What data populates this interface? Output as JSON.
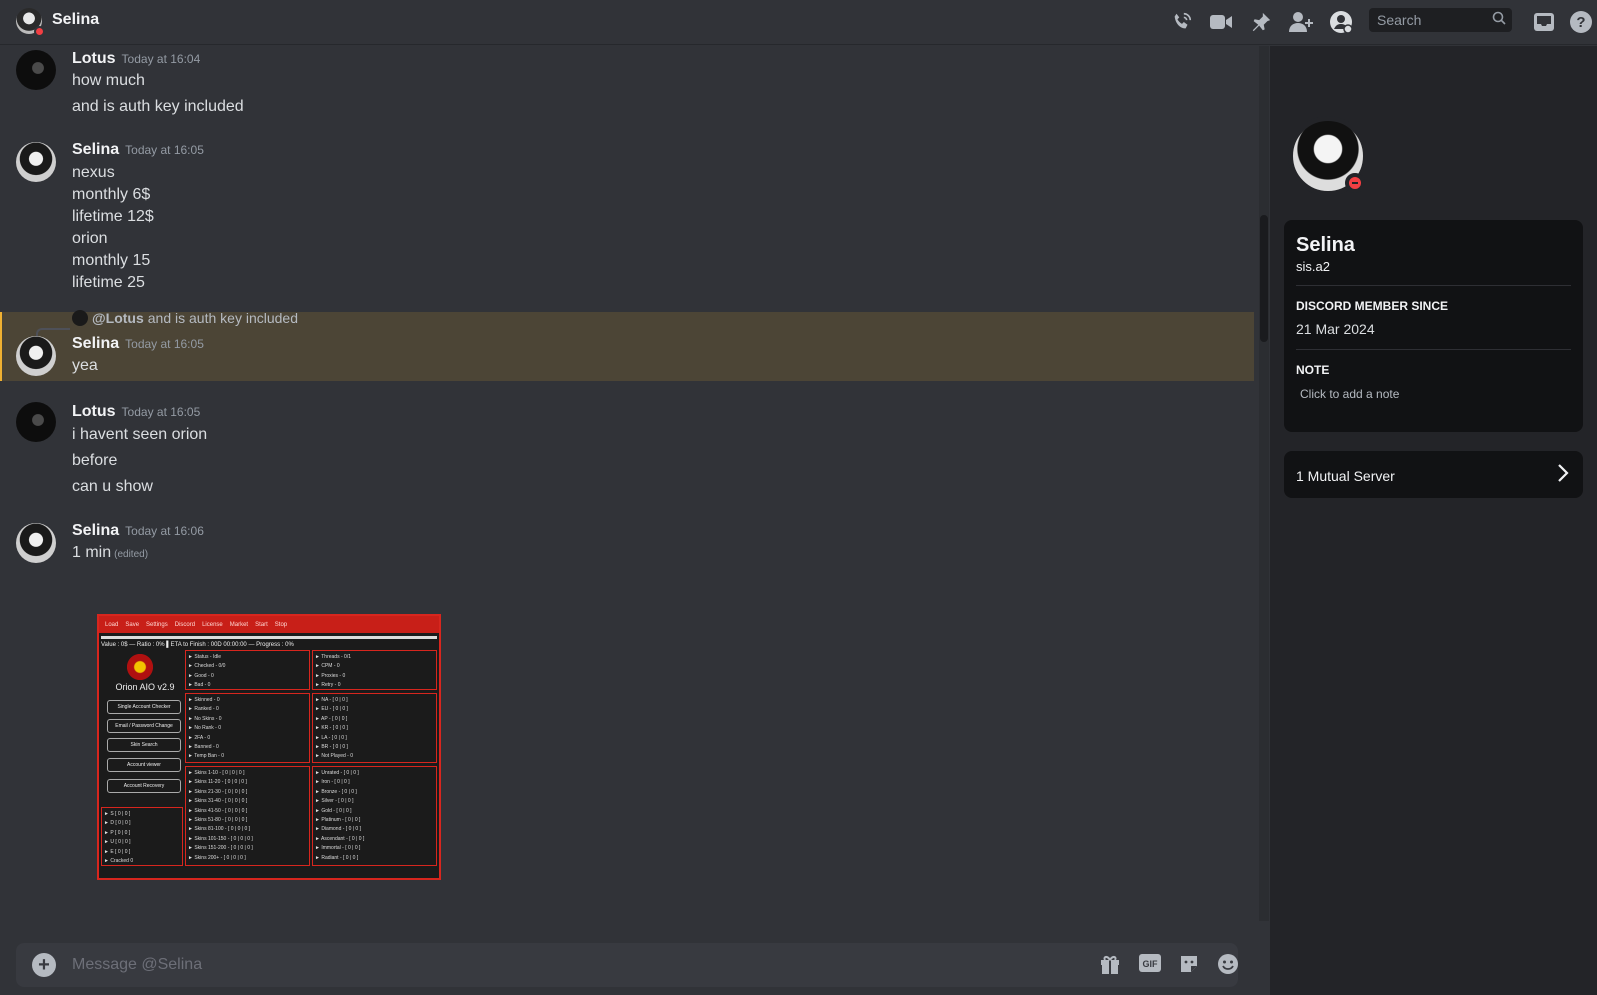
{
  "header": {
    "title": "Selina",
    "search_placeholder": "Search",
    "icons": [
      "call-icon",
      "video-icon",
      "pin-icon",
      "add-friend-icon",
      "profile-icon",
      "inbox-icon",
      "help-icon"
    ]
  },
  "messages": [
    {
      "author": "Lotus",
      "time": "Today at 16:04",
      "lines": [
        "how much",
        "and is auth key included"
      ]
    },
    {
      "author": "Selina",
      "time": "Today at 16:05",
      "lines": [
        "nexus",
        "monthly 6$",
        "lifetime 12$",
        "orion",
        "monthly 15",
        "lifetime 25"
      ]
    },
    {
      "author": "Selina",
      "time": "Today at 16:05",
      "reply": {
        "mention": "@Lotus",
        "text": "and is auth key included"
      },
      "lines": [
        "yea"
      ]
    },
    {
      "author": "Lotus",
      "time": "Today at 16:05",
      "lines": [
        "i havent seen orion",
        "before",
        "can u show"
      ]
    },
    {
      "author": "Selina",
      "time": "Today at 16:06",
      "lines": [
        "1 min"
      ],
      "edited": "(edited)"
    }
  ],
  "attachment": {
    "toolbar": [
      "Load",
      "Save",
      "Settings",
      "Discord",
      "License",
      "Market",
      "Start",
      "Stop"
    ],
    "stats": "Value : 0$  —  Ratio : 0%   ▌ETA to Finish : 00D 00:00:00  —  Progress : 0%",
    "brand": "Orion AIO v2.9",
    "buttons": [
      "Single Account Checker",
      "Email / Password Change",
      "Skin Search",
      "Account viewer",
      "Account Recovery"
    ],
    "panel_status": [
      "► Status    - Idle",
      "► Checked   - 0/0",
      "► Good      - 0",
      "► Bad       - 0"
    ],
    "panel_threads": [
      "► Threads   - 0/1",
      "► CPM       - 0",
      "► Proxies   - 0",
      "► Retry     - 0"
    ],
    "panel_skinned": [
      "► Skinned   - 0",
      "► Ranked    - 0",
      "► No Skins  - 0",
      "► No Rank   - 0",
      "► 2FA       - 0",
      "► Banned    - 0",
      "► Temp Ban  - 0"
    ],
    "panel_regions": [
      "► NA   - [ 0 | 0 ]",
      "► EU   - [ 0 | 0 ]",
      "► AP   - [ 0 | 0 ]",
      "► KR   - [ 0 | 0 ]",
      "► LA   - [ 0 | 0 ]",
      "► BR   - [ 0 | 0 ]",
      "► Not Played - 0"
    ],
    "panel_skins": [
      "► Skins 1-10   - [ 0 | 0 | 0 ]",
      "► Skins 11-20  - [ 0 | 0 | 0 ]",
      "► Skins 21-30  - [ 0 | 0 | 0 ]",
      "► Skins 31-40  - [ 0 | 0 | 0 ]",
      "► Skins 41-50  - [ 0 | 0 | 0 ]",
      "► Skins 51-80  - [ 0 | 0 | 0 ]",
      "► Skins 81-100 - [ 0 | 0 | 0 ]",
      "► Skins 101-150 - [ 0 | 0 | 0 ]",
      "► Skins 151-200 - [ 0 | 0 | 0 ]",
      "► Skins 200+  - [ 0 | 0 | 0 ]"
    ],
    "panel_ranks": [
      "► Unrated   - [ 0 | 0 ]",
      "► Iron      - [ 0 | 0 ]",
      "► Bronze    - [ 0 | 0 ]",
      "► Silver    - [ 0 | 0 ]",
      "► Gold      - [ 0 | 0 ]",
      "► Platinum  - [ 0 | 0 ]",
      "► Diamond   - [ 0 | 0 ]",
      "► Ascendant - [ 0 | 0 ]",
      "► Immortal  - [ 0 | 0 ]",
      "► Radiant   - [ 0 | 0 ]"
    ],
    "panel_sdpue": [
      "► S     [ 0 | 0 ]",
      "► D     [ 0 | 0 ]",
      "► P     [ 0 | 0 ]",
      "► U     [ 0 | 0 ]",
      "► E     [ 0 | 0 ]",
      "► Cracked   0"
    ]
  },
  "composer": {
    "placeholder": "Message @Selina",
    "icons": [
      "gift-icon",
      "gif-icon",
      "sticker-icon",
      "emoji-icon"
    ]
  },
  "profile": {
    "name": "Selina",
    "username": "sis.a2",
    "member_since_label": "DISCORD MEMBER SINCE",
    "member_since": "21 Mar 2024",
    "note_label": "NOTE",
    "note_placeholder": "Click to add a note",
    "mutual": "1 Mutual Server"
  },
  "colors": {
    "accent_dnd": "#f23f43",
    "highlight": "#4c4536",
    "highlight_bar": "#f0b132"
  }
}
